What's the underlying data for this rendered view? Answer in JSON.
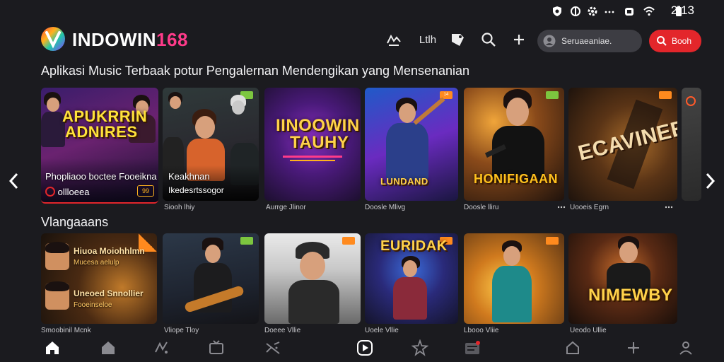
{
  "status": {
    "time": "2:13"
  },
  "header": {
    "brand_main": "INDOWIN",
    "brand_num": "168",
    "nav_label": "Ltlh",
    "search_placeholder": "Seruaeaniae.",
    "book_label": "Booh"
  },
  "section1": {
    "title": "Aplikasi Music Terbaak potur Pengalernan Mendengikan yang Mensenanian",
    "featured": {
      "title_line1": "APUKRRIN",
      "title_line2": "ADNIRES",
      "overlay_text": "Phopliaoo boctee Fooeikna",
      "play_text": "ollloeea",
      "tag": "99"
    },
    "cards": [
      {
        "overlay_text": "Keakhnan",
        "overlay_sub": "Ikedesrtssogor",
        "caption": "Siooh lhiy"
      },
      {
        "title_line1": "IINOOWIN",
        "title_line2": "TAUHY",
        "caption": "Aurrge Jlinor"
      },
      {
        "caption": "Doosle Mlivg",
        "title_line1": "LUNDAND",
        "badge": "14"
      },
      {
        "title_line1": "HONIFIGAAN",
        "caption": "Doosle lliru"
      },
      {
        "title_line1": "ECAVINEES",
        "caption": "Uooeis Egrn"
      }
    ]
  },
  "section2": {
    "title": "Vlangaaans",
    "featured": {
      "row1_title": "Hiuoa Moiohhlmn",
      "row1_sub": "Mucesa aelulp",
      "row2_title": "Uneoed Snnollier",
      "row2_sub": "Fooeinseloe",
      "caption": "Smoobinil Mcnk"
    },
    "cards": [
      {
        "caption": "Vliope Tloy"
      },
      {
        "caption": "Doeee Vllie"
      },
      {
        "title_line1": "EURIDAK",
        "caption": "Uoele Vllie"
      },
      {
        "caption": "Lbooo Vliie"
      },
      {
        "title_line1": "NIMEWBY",
        "caption": "Ueodo Ullie"
      }
    ]
  },
  "colors": {
    "background": "#1b1b1f",
    "accent_red": "#e3262b",
    "brand_pink": "#ff3b8a"
  },
  "icons": [
    "home-icon",
    "library-icon",
    "explore-icon",
    "radio-icon",
    "shuffle-icon",
    "play-icon",
    "star-icon",
    "queue-icon",
    "house-icon",
    "move-icon",
    "profile-icon"
  ]
}
